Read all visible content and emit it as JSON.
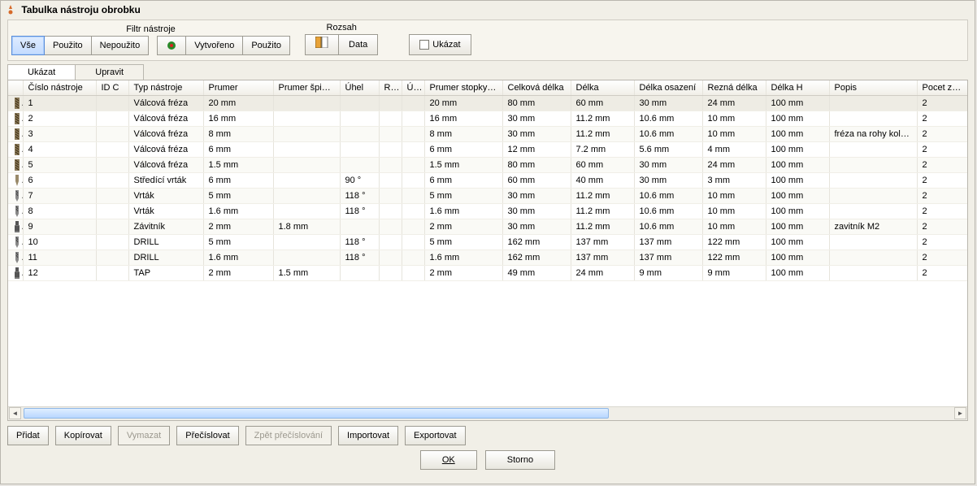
{
  "window": {
    "title": "Tabulka nástroju obrobku"
  },
  "filter": {
    "title": "Filtr nástroje",
    "all": "Vše",
    "used": "Použito",
    "unused": "Nepoužito",
    "created": "Vytvořeno",
    "usedBtn": "Použito"
  },
  "range": {
    "title": "Rozsah",
    "data": "Data"
  },
  "show": {
    "label": "Ukázat"
  },
  "tabs": {
    "show": "Ukázat",
    "edit": "Upravit"
  },
  "columns": {
    "icon": "",
    "toolNo": "Číslo nástroje",
    "idc": "ID C",
    "toolType": "Typ nástroje",
    "dia": "Prumer",
    "tipDia": "Prumer špicky",
    "angle": "Úhel",
    "r": "R…",
    "u": "Ú…",
    "shankDia": "Prumer stopky…",
    "totalLen": "Celková délka",
    "length": "Délka",
    "shoulderLen": "Délka osazení",
    "cutLen": "Rezná délka",
    "lenH": "Délka H",
    "desc": "Popis",
    "teeth": "Pocet zubu"
  },
  "rows": [
    {
      "no": "1",
      "idc": "",
      "type": "Válcová fréza",
      "dia": "20 mm",
      "tip": "",
      "ang": "",
      "r": "",
      "u": "",
      "shank": "20 mm",
      "tot": "80 mm",
      "len": "60 mm",
      "shld": "30 mm",
      "cut": "24 mm",
      "h": "100 mm",
      "desc": "",
      "teeth": "2",
      "icon": "endmill"
    },
    {
      "no": "2",
      "idc": "",
      "type": "Válcová fréza",
      "dia": "16 mm",
      "tip": "",
      "ang": "",
      "r": "",
      "u": "",
      "shank": "16 mm",
      "tot": "30 mm",
      "len": "11.2 mm",
      "shld": "10.6 mm",
      "cut": "10 mm",
      "h": "100 mm",
      "desc": "",
      "teeth": "2",
      "icon": "endmill"
    },
    {
      "no": "3",
      "idc": "",
      "type": "Válcová fréza",
      "dia": "8 mm",
      "tip": "",
      "ang": "",
      "r": "",
      "u": "",
      "shank": "8 mm",
      "tot": "30 mm",
      "len": "11.2 mm",
      "shld": "10.6 mm",
      "cut": "10 mm",
      "h": "100 mm",
      "desc": "fréza na rohy kolem…",
      "teeth": "2",
      "icon": "endmill"
    },
    {
      "no": "4",
      "idc": "",
      "type": "Válcová fréza",
      "dia": "6 mm",
      "tip": "",
      "ang": "",
      "r": "",
      "u": "",
      "shank": "6 mm",
      "tot": "12 mm",
      "len": "7.2 mm",
      "shld": "5.6 mm",
      "cut": "4 mm",
      "h": "100 mm",
      "desc": "",
      "teeth": "2",
      "icon": "endmill"
    },
    {
      "no": "5",
      "idc": "",
      "type": "Válcová fréza",
      "dia": "1.5 mm",
      "tip": "",
      "ang": "",
      "r": "",
      "u": "",
      "shank": "1.5 mm",
      "tot": "80 mm",
      "len": "60 mm",
      "shld": "30 mm",
      "cut": "24 mm",
      "h": "100 mm",
      "desc": "",
      "teeth": "2",
      "icon": "endmill"
    },
    {
      "no": "6",
      "idc": "",
      "type": "Středící vrták",
      "dia": "6 mm",
      "tip": "",
      "ang": "90 °",
      "r": "",
      "u": "",
      "shank": "6 mm",
      "tot": "60 mm",
      "len": "40 mm",
      "shld": "30 mm",
      "cut": "3 mm",
      "h": "100 mm",
      "desc": "",
      "teeth": "2",
      "icon": "spot"
    },
    {
      "no": "7",
      "idc": "",
      "type": "Vrták",
      "dia": "5 mm",
      "tip": "",
      "ang": "118 °",
      "r": "",
      "u": "",
      "shank": "5 mm",
      "tot": "30 mm",
      "len": "11.2 mm",
      "shld": "10.6 mm",
      "cut": "10 mm",
      "h": "100 mm",
      "desc": "",
      "teeth": "2",
      "icon": "drill"
    },
    {
      "no": "8",
      "idc": "",
      "type": "Vrták",
      "dia": "1.6 mm",
      "tip": "",
      "ang": "118 °",
      "r": "",
      "u": "",
      "shank": "1.6 mm",
      "tot": "30 mm",
      "len": "11.2 mm",
      "shld": "10.6 mm",
      "cut": "10 mm",
      "h": "100 mm",
      "desc": "",
      "teeth": "2",
      "icon": "drill"
    },
    {
      "no": "9",
      "idc": "",
      "type": "Závitník",
      "dia": "2 mm",
      "tip": "1.8 mm",
      "ang": "",
      "r": "",
      "u": "",
      "shank": "2 mm",
      "tot": "30 mm",
      "len": "11.2 mm",
      "shld": "10.6 mm",
      "cut": "10 mm",
      "h": "100 mm",
      "desc": "zavitník M2",
      "teeth": "2",
      "icon": "tap"
    },
    {
      "no": "10",
      "idc": "",
      "type": "DRILL",
      "dia": "5 mm",
      "tip": "",
      "ang": "118 °",
      "r": "",
      "u": "",
      "shank": "5 mm",
      "tot": "162 mm",
      "len": "137 mm",
      "shld": "137 mm",
      "cut": "122 mm",
      "h": "100 mm",
      "desc": "",
      "teeth": "2",
      "icon": "drill"
    },
    {
      "no": "11",
      "idc": "",
      "type": "DRILL",
      "dia": "1.6 mm",
      "tip": "",
      "ang": "118 °",
      "r": "",
      "u": "",
      "shank": "1.6 mm",
      "tot": "162 mm",
      "len": "137 mm",
      "shld": "137 mm",
      "cut": "122 mm",
      "h": "100 mm",
      "desc": "",
      "teeth": "2",
      "icon": "drill"
    },
    {
      "no": "12",
      "idc": "",
      "type": "TAP",
      "dia": "2 mm",
      "tip": "1.5 mm",
      "ang": "",
      "r": "",
      "u": "",
      "shank": "2 mm",
      "tot": "49 mm",
      "len": "24 mm",
      "shld": "9 mm",
      "cut": "9 mm",
      "h": "100 mm",
      "desc": "",
      "teeth": "2",
      "icon": "tap"
    }
  ],
  "btns": {
    "add": "Přidat",
    "copy": "Kopírovat",
    "delete": "Vymazat",
    "renumber": "Přečíslovat",
    "undoRenumber": "Zpět přečíslování",
    "import": "Importovat",
    "export": "Exportovat",
    "ok": "OK",
    "cancel": "Storno"
  }
}
